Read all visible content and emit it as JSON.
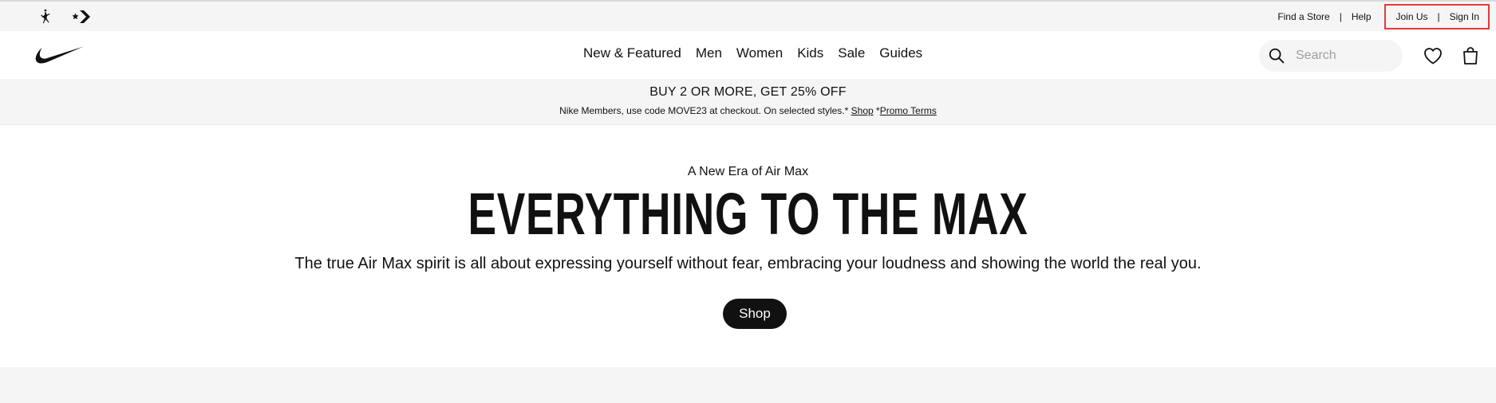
{
  "utility_bar": {
    "brand_icons": [
      "jordan-jumpman-icon",
      "converse-chevron-icon"
    ],
    "links": {
      "find_store": "Find a Store",
      "help": "Help",
      "join_us": "Join Us",
      "sign_in": "Sign In",
      "separator": "|"
    }
  },
  "header": {
    "logo": "nike-swoosh-logo",
    "nav": [
      "New & Featured",
      "Men",
      "Women",
      "Kids",
      "Sale",
      "Guides"
    ],
    "search": {
      "placeholder": "Search",
      "value": ""
    },
    "icons": [
      "search-icon",
      "heart-icon",
      "bag-icon"
    ]
  },
  "promo": {
    "title": "BUY 2 OR MORE, GET 25% OFF",
    "text": "Nike Members, use code MOVE23 at checkout. On selected styles.*",
    "shop_link": "Shop",
    "terms_prefix": "*",
    "terms_link": "Promo Terms"
  },
  "hero": {
    "kicker": "A New Era of Air Max",
    "title": "EVERYTHING TO THE MAX",
    "description": "The true Air Max spirit is all about expressing yourself without fear, embracing your loudness and showing the world the real you.",
    "cta": "Shop"
  },
  "colors": {
    "text": "#111111",
    "band_bg": "#f5f5f5",
    "highlight_border": "#e53935",
    "cta_bg": "#111111",
    "cta_text": "#ffffff"
  }
}
